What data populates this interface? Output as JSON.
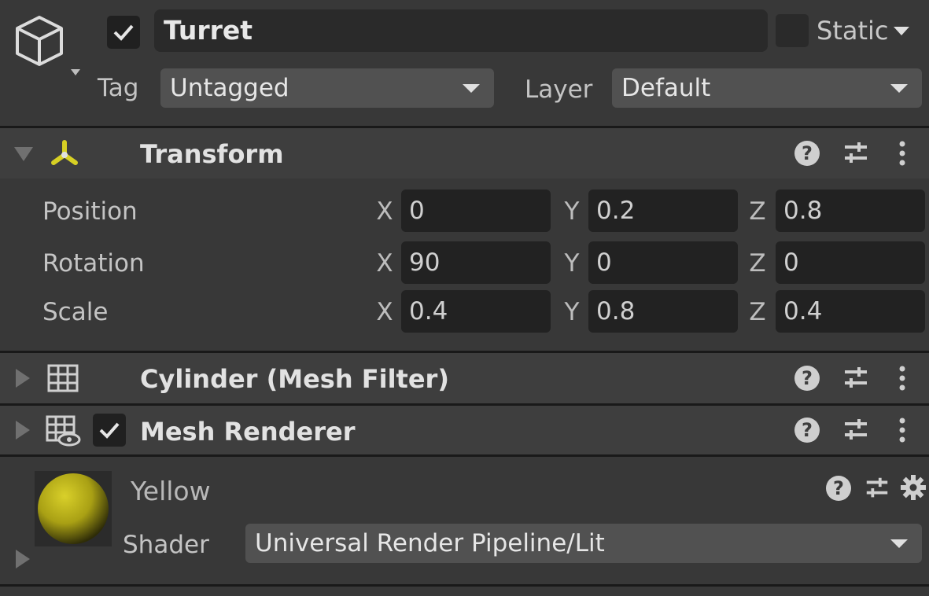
{
  "header": {
    "object_name": "Turret",
    "active_checked": true,
    "static_label": "Static",
    "static_checked": false,
    "tag_label": "Tag",
    "tag_value": "Untagged",
    "layer_label": "Layer",
    "layer_value": "Default",
    "object_icon": "cube-icon"
  },
  "transform": {
    "title": "Transform",
    "icon": "transform-axes-icon",
    "rows": [
      {
        "label": "Position",
        "x": "0",
        "y": "0.2",
        "z": "0.8"
      },
      {
        "label": "Rotation",
        "x": "90",
        "y": "0",
        "z": "0"
      },
      {
        "label": "Scale",
        "x": "0.4",
        "y": "0.8",
        "z": "0.4"
      }
    ],
    "axes": [
      "X",
      "Y",
      "Z"
    ]
  },
  "mesh_filter": {
    "title": "Cylinder (Mesh Filter)",
    "icon": "grid-icon"
  },
  "mesh_renderer": {
    "title": "Mesh Renderer",
    "icon": "grid-eye-icon",
    "enabled": true
  },
  "material": {
    "name": "Yellow",
    "shader_label": "Shader",
    "shader_value": "Universal Render Pipeline/Lit",
    "preview_color": "#bdb31a"
  },
  "colors": {
    "background": "#383838",
    "header_bar": "#3e3e3e",
    "field": "#222222",
    "dropdown": "#515151",
    "transform_icon": "#d7d024"
  }
}
